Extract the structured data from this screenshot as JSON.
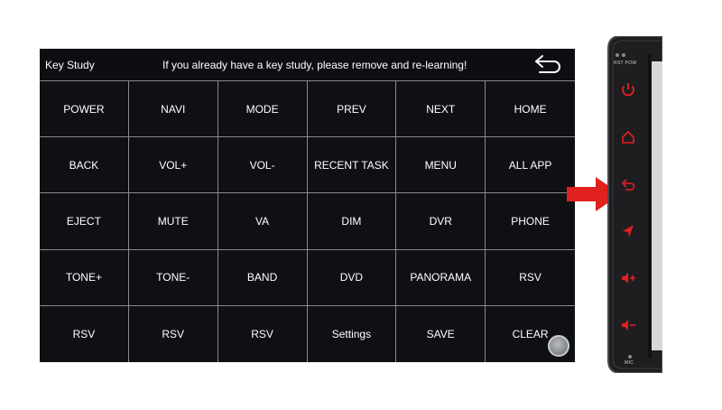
{
  "header": {
    "title": "Key Study",
    "message": "If you already have a key study, please remove and re-learning!"
  },
  "keys": [
    "POWER",
    "NAVI",
    "MODE",
    "PREV",
    "NEXT",
    "HOME",
    "BACK",
    "VOL+",
    "VOL-",
    "RECENT TASK",
    "MENU",
    "ALL APP",
    "EJECT",
    "MUTE",
    "VA",
    "DIM",
    "DVR",
    "PHONE",
    "TONE+",
    "TONE-",
    "BAND",
    "DVD",
    "PANORAMA",
    "RSV",
    "RSV",
    "RSV",
    "RSV",
    "Settings",
    "SAVE",
    "CLEAR"
  ],
  "device": {
    "top_label": "RST POW",
    "bottom_label": "MIC",
    "buttons": [
      "power-icon",
      "home-icon",
      "back-icon",
      "navigation-icon",
      "volume-up-icon",
      "volume-down-icon"
    ]
  },
  "colors": {
    "screen_bg": "#0f1014",
    "grid_line": "#8a8a8a",
    "accent_red": "#e02020",
    "device_body": "#2a2a2c"
  }
}
